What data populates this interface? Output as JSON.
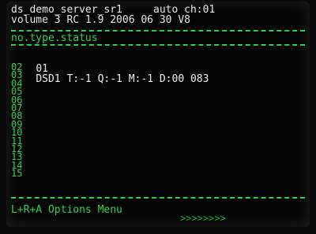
{
  "header": {
    "line1": "ds_demo_server_sr1     auto ch:01",
    "line2": "volume 3 RC 1.9 2006 06 30 V8"
  },
  "columns": "no.type.status",
  "rows": [
    {
      "no": "01",
      "status": "DSD1 T:-1 Q:-1 M:-1 D:00 083"
    }
  ],
  "empty_slots": [
    "02",
    "03",
    "04",
    "05",
    "06",
    "07",
    "08",
    "09",
    "10",
    "11",
    "12",
    "13",
    "14",
    "15"
  ],
  "footer": {
    "hint": "L+R+A Options Menu",
    "arrows": ">>>>>>>>"
  },
  "colors": {
    "accent": "#36d04f",
    "text": "#e8e8e8",
    "background": "#050505"
  }
}
